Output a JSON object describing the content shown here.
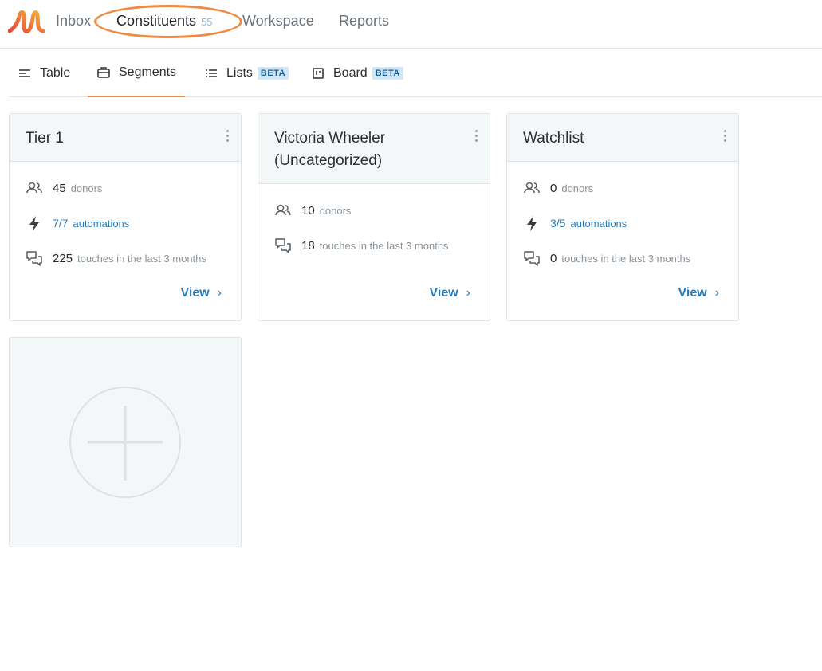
{
  "nav": {
    "items": [
      {
        "label": "Inbox"
      },
      {
        "label": "Constituents",
        "count": "55"
      },
      {
        "label": "Workspace"
      },
      {
        "label": "Reports"
      }
    ]
  },
  "subtabs": [
    {
      "label": "Table",
      "icon": "table-icon"
    },
    {
      "label": "Segments",
      "icon": "segments-icon",
      "active": true
    },
    {
      "label": "Lists",
      "icon": "list-icon",
      "badge": "BETA"
    },
    {
      "label": "Board",
      "icon": "board-icon",
      "badge": "BETA"
    }
  ],
  "cards": [
    {
      "title": "Tier 1",
      "donors": "45",
      "donors_label": "donors",
      "automations": "7/7",
      "automations_label": "automations",
      "touches": "225",
      "touches_label": "touches in the last 3 months",
      "view_label": "View"
    },
    {
      "title": "Victoria Wheeler (Uncategorized)",
      "donors": "10",
      "donors_label": "donors",
      "touches": "18",
      "touches_label": "touches in the last 3 months",
      "view_label": "View"
    },
    {
      "title": "Watchlist",
      "donors": "0",
      "donors_label": "donors",
      "automations": "3/5",
      "automations_label": "automations",
      "touches": "0",
      "touches_label": "touches in the last 3 months",
      "view_label": "View"
    }
  ],
  "colors": {
    "accent": "#f08a43",
    "link": "#2a7ab8",
    "badge_bg": "#cfe6f7"
  }
}
